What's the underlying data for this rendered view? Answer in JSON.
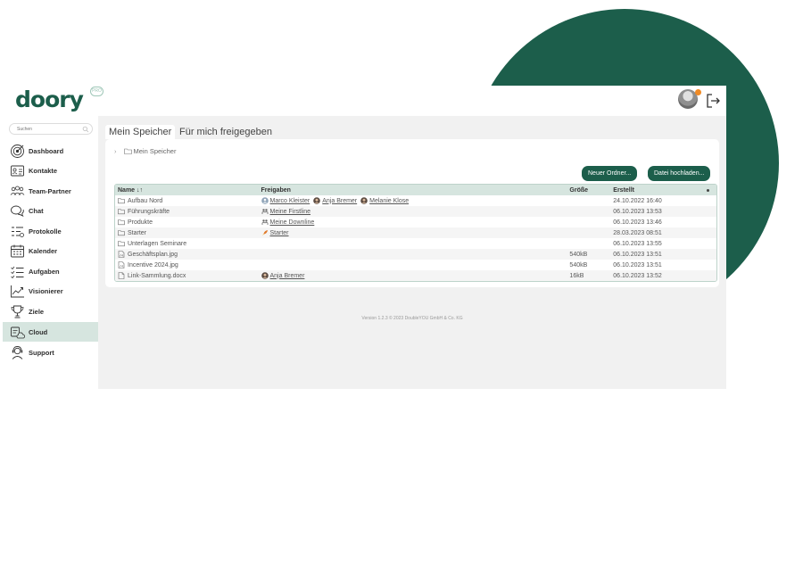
{
  "colors": {
    "brand": "#1c5e4b",
    "accent": "#f08a24",
    "active_bg": "#d6e5df"
  },
  "header": {
    "logo": "doory",
    "logo_badge": "PRO"
  },
  "sidebar": {
    "search_placeholder": "Suchen",
    "items": [
      {
        "label": "Dashboard",
        "icon": "target-icon"
      },
      {
        "label": "Kontakte",
        "icon": "contact-card-icon"
      },
      {
        "label": "Team-Partner",
        "icon": "team-icon"
      },
      {
        "label": "Chat",
        "icon": "chat-icon"
      },
      {
        "label": "Protokolle",
        "icon": "protocol-list-icon"
      },
      {
        "label": "Kalender",
        "icon": "calendar-icon"
      },
      {
        "label": "Aufgaben",
        "icon": "checklist-icon"
      },
      {
        "label": "Visionierer",
        "icon": "chart-trend-icon"
      },
      {
        "label": "Ziele",
        "icon": "trophy-icon"
      },
      {
        "label": "Cloud",
        "icon": "cloud-icon",
        "active": true
      },
      {
        "label": "Support",
        "icon": "support-headset-icon"
      }
    ]
  },
  "tabs": [
    {
      "label": "Mein Speicher",
      "active": true
    },
    {
      "label": "Für mich freigegeben",
      "active": false
    }
  ],
  "breadcrumb": {
    "folder": "Mein Speicher"
  },
  "buttons": {
    "new_folder": "Neuer Ordner...",
    "upload": "Datei hochladen..."
  },
  "table": {
    "headers": {
      "name": "Name ↓↑",
      "share": "Freigaben",
      "size": "Größe",
      "created": "Erstellt"
    },
    "rows": [
      {
        "type": "folder",
        "name": "Aufbau Nord",
        "shares": [
          {
            "icon": "avatar-group-icon",
            "label": "Marco Kleister"
          },
          {
            "icon": "avatar-icon",
            "label": "Anja Bremer"
          },
          {
            "icon": "avatar-icon",
            "label": "Melanie Klose"
          }
        ],
        "size": "",
        "created": "24.10.2022 16:40"
      },
      {
        "type": "folder",
        "name": "Führungskräfte",
        "shares": [
          {
            "icon": "people-icon",
            "label": "Meine Firstline"
          }
        ],
        "size": "",
        "created": "06.10.2023 13:53"
      },
      {
        "type": "folder",
        "name": "Produkte",
        "shares": [
          {
            "icon": "people-icon",
            "label": "Meine Downline"
          }
        ],
        "size": "",
        "created": "06.10.2023 13:46"
      },
      {
        "type": "folder",
        "name": "Starter",
        "shares": [
          {
            "icon": "rocket-icon",
            "label": "Starter"
          }
        ],
        "size": "",
        "created": "28.03.2023 08:51"
      },
      {
        "type": "folder",
        "name": "Unterlagen Seminare",
        "shares": [],
        "size": "",
        "created": "06.10.2023 13:55"
      },
      {
        "type": "image",
        "name": "Geschäftsplan.jpg",
        "shares": [],
        "size": "540kB",
        "created": "06.10.2023 13:51"
      },
      {
        "type": "image",
        "name": "Incentive 2024.jpg",
        "shares": [],
        "size": "540kB",
        "created": "06.10.2023 13:51"
      },
      {
        "type": "file",
        "name": "Link-Sammlung.docx",
        "shares": [
          {
            "icon": "avatar-icon",
            "label": "Anja Bremer"
          }
        ],
        "size": "16kB",
        "created": "06.10.2023 13:52"
      }
    ]
  },
  "footer": "Version 1.2.3 © 2023 DoubleYOU GmbH & Co. KG"
}
